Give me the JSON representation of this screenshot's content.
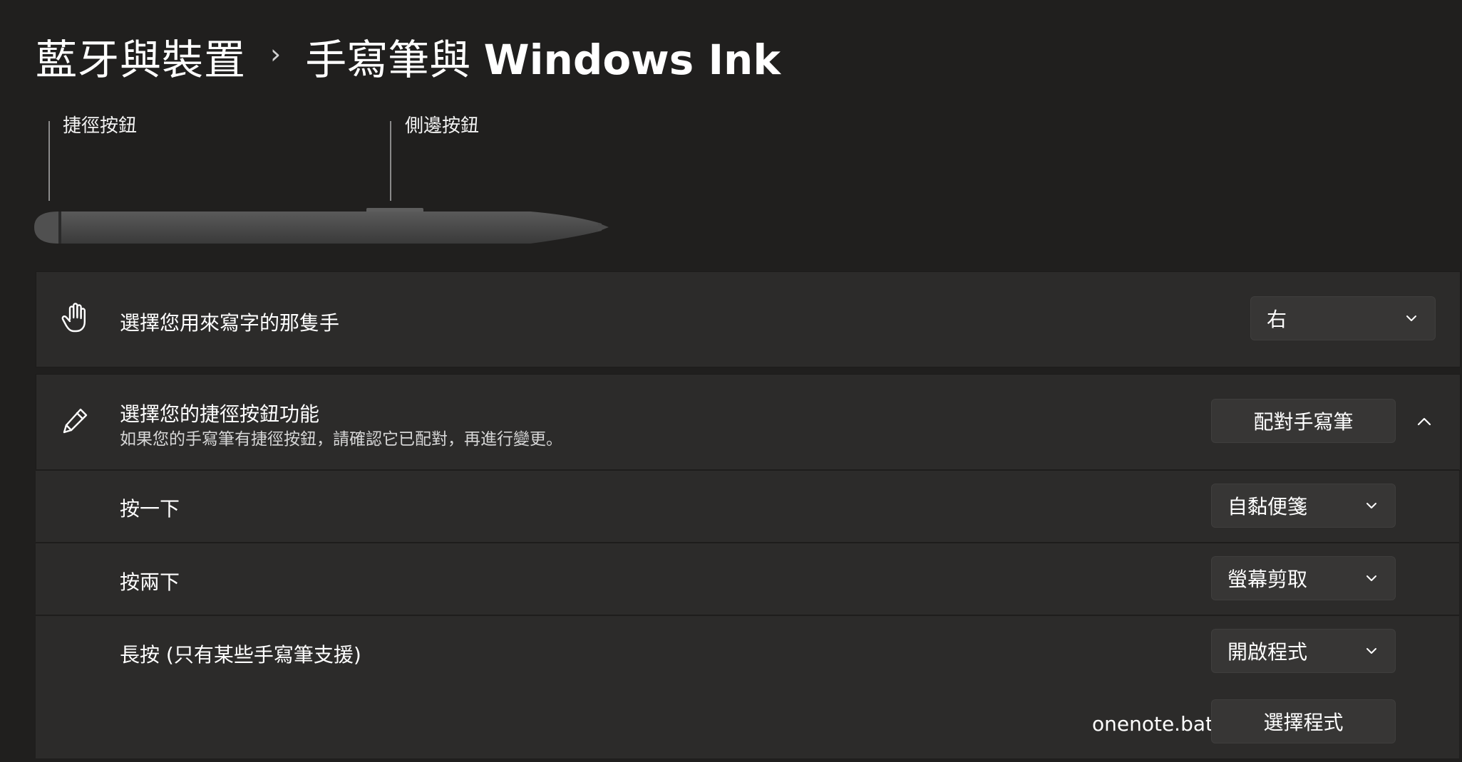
{
  "breadcrumb": {
    "parent": "藍牙與裝置",
    "separator": "›",
    "current_prefix": "手寫筆與",
    "current_suffix": "Windows Ink"
  },
  "pen": {
    "shortcut_button_label": "捷徑按鈕",
    "side_button_label": "側邊按鈕"
  },
  "handedness": {
    "icon": "hand-icon",
    "title": "選擇您用來寫字的那隻手",
    "value": "右"
  },
  "shortcut": {
    "icon": "pen-icon",
    "title": "選擇您的捷徑按鈕功能",
    "subtitle": "如果您的手寫筆有捷徑按鈕，請確認它已配對，再進行變更。",
    "pair_button": "配對手寫筆",
    "expanded": true,
    "rows": [
      {
        "label": "按一下",
        "value": "自黏便箋"
      },
      {
        "label": "按兩下",
        "value": "螢幕剪取"
      },
      {
        "label": "長按 (只有某些手寫筆支援)",
        "value": "開啟程式"
      }
    ],
    "program_file": "onenote.bat",
    "choose_program_button": "選擇程式"
  },
  "colors": {
    "background": "#201f1e",
    "card": "#2c2b2a",
    "control": "#373635",
    "text": "#ffffff"
  }
}
